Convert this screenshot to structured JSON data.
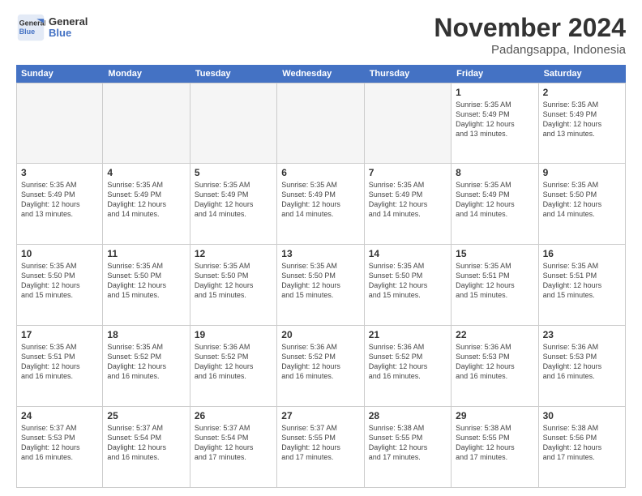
{
  "logo": {
    "line1": "General",
    "line2": "Blue"
  },
  "title": "November 2024",
  "location": "Padangsappa, Indonesia",
  "header": {
    "days": [
      "Sunday",
      "Monday",
      "Tuesday",
      "Wednesday",
      "Thursday",
      "Friday",
      "Saturday"
    ]
  },
  "weeks": [
    {
      "cells": [
        {
          "day": "",
          "empty": true,
          "info": ""
        },
        {
          "day": "",
          "empty": true,
          "info": ""
        },
        {
          "day": "",
          "empty": true,
          "info": ""
        },
        {
          "day": "",
          "empty": true,
          "info": ""
        },
        {
          "day": "",
          "empty": true,
          "info": ""
        },
        {
          "day": "1",
          "empty": false,
          "info": "Sunrise: 5:35 AM\nSunset: 5:49 PM\nDaylight: 12 hours\nand 13 minutes."
        },
        {
          "day": "2",
          "empty": false,
          "info": "Sunrise: 5:35 AM\nSunset: 5:49 PM\nDaylight: 12 hours\nand 13 minutes."
        }
      ]
    },
    {
      "cells": [
        {
          "day": "3",
          "empty": false,
          "info": "Sunrise: 5:35 AM\nSunset: 5:49 PM\nDaylight: 12 hours\nand 13 minutes."
        },
        {
          "day": "4",
          "empty": false,
          "info": "Sunrise: 5:35 AM\nSunset: 5:49 PM\nDaylight: 12 hours\nand 14 minutes."
        },
        {
          "day": "5",
          "empty": false,
          "info": "Sunrise: 5:35 AM\nSunset: 5:49 PM\nDaylight: 12 hours\nand 14 minutes."
        },
        {
          "day": "6",
          "empty": false,
          "info": "Sunrise: 5:35 AM\nSunset: 5:49 PM\nDaylight: 12 hours\nand 14 minutes."
        },
        {
          "day": "7",
          "empty": false,
          "info": "Sunrise: 5:35 AM\nSunset: 5:49 PM\nDaylight: 12 hours\nand 14 minutes."
        },
        {
          "day": "8",
          "empty": false,
          "info": "Sunrise: 5:35 AM\nSunset: 5:49 PM\nDaylight: 12 hours\nand 14 minutes."
        },
        {
          "day": "9",
          "empty": false,
          "info": "Sunrise: 5:35 AM\nSunset: 5:50 PM\nDaylight: 12 hours\nand 14 minutes."
        }
      ]
    },
    {
      "cells": [
        {
          "day": "10",
          "empty": false,
          "info": "Sunrise: 5:35 AM\nSunset: 5:50 PM\nDaylight: 12 hours\nand 15 minutes."
        },
        {
          "day": "11",
          "empty": false,
          "info": "Sunrise: 5:35 AM\nSunset: 5:50 PM\nDaylight: 12 hours\nand 15 minutes."
        },
        {
          "day": "12",
          "empty": false,
          "info": "Sunrise: 5:35 AM\nSunset: 5:50 PM\nDaylight: 12 hours\nand 15 minutes."
        },
        {
          "day": "13",
          "empty": false,
          "info": "Sunrise: 5:35 AM\nSunset: 5:50 PM\nDaylight: 12 hours\nand 15 minutes."
        },
        {
          "day": "14",
          "empty": false,
          "info": "Sunrise: 5:35 AM\nSunset: 5:50 PM\nDaylight: 12 hours\nand 15 minutes."
        },
        {
          "day": "15",
          "empty": false,
          "info": "Sunrise: 5:35 AM\nSunset: 5:51 PM\nDaylight: 12 hours\nand 15 minutes."
        },
        {
          "day": "16",
          "empty": false,
          "info": "Sunrise: 5:35 AM\nSunset: 5:51 PM\nDaylight: 12 hours\nand 15 minutes."
        }
      ]
    },
    {
      "cells": [
        {
          "day": "17",
          "empty": false,
          "info": "Sunrise: 5:35 AM\nSunset: 5:51 PM\nDaylight: 12 hours\nand 16 minutes."
        },
        {
          "day": "18",
          "empty": false,
          "info": "Sunrise: 5:35 AM\nSunset: 5:52 PM\nDaylight: 12 hours\nand 16 minutes."
        },
        {
          "day": "19",
          "empty": false,
          "info": "Sunrise: 5:36 AM\nSunset: 5:52 PM\nDaylight: 12 hours\nand 16 minutes."
        },
        {
          "day": "20",
          "empty": false,
          "info": "Sunrise: 5:36 AM\nSunset: 5:52 PM\nDaylight: 12 hours\nand 16 minutes."
        },
        {
          "day": "21",
          "empty": false,
          "info": "Sunrise: 5:36 AM\nSunset: 5:52 PM\nDaylight: 12 hours\nand 16 minutes."
        },
        {
          "day": "22",
          "empty": false,
          "info": "Sunrise: 5:36 AM\nSunset: 5:53 PM\nDaylight: 12 hours\nand 16 minutes."
        },
        {
          "day": "23",
          "empty": false,
          "info": "Sunrise: 5:36 AM\nSunset: 5:53 PM\nDaylight: 12 hours\nand 16 minutes."
        }
      ]
    },
    {
      "cells": [
        {
          "day": "24",
          "empty": false,
          "info": "Sunrise: 5:37 AM\nSunset: 5:53 PM\nDaylight: 12 hours\nand 16 minutes."
        },
        {
          "day": "25",
          "empty": false,
          "info": "Sunrise: 5:37 AM\nSunset: 5:54 PM\nDaylight: 12 hours\nand 16 minutes."
        },
        {
          "day": "26",
          "empty": false,
          "info": "Sunrise: 5:37 AM\nSunset: 5:54 PM\nDaylight: 12 hours\nand 17 minutes."
        },
        {
          "day": "27",
          "empty": false,
          "info": "Sunrise: 5:37 AM\nSunset: 5:55 PM\nDaylight: 12 hours\nand 17 minutes."
        },
        {
          "day": "28",
          "empty": false,
          "info": "Sunrise: 5:38 AM\nSunset: 5:55 PM\nDaylight: 12 hours\nand 17 minutes."
        },
        {
          "day": "29",
          "empty": false,
          "info": "Sunrise: 5:38 AM\nSunset: 5:55 PM\nDaylight: 12 hours\nand 17 minutes."
        },
        {
          "day": "30",
          "empty": false,
          "info": "Sunrise: 5:38 AM\nSunset: 5:56 PM\nDaylight: 12 hours\nand 17 minutes."
        }
      ]
    }
  ]
}
